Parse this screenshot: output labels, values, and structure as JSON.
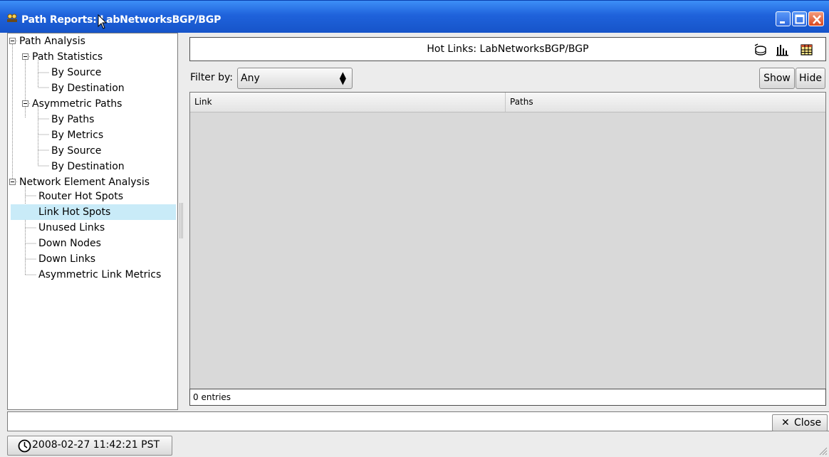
{
  "window": {
    "title": "Path Reports: LabNetworksBGP/BGP"
  },
  "tree": {
    "items": [
      {
        "label": "Path Analysis",
        "expander": "−"
      },
      {
        "label": "Path Statistics",
        "expander": "−"
      },
      {
        "label": "By Source"
      },
      {
        "label": "By Destination"
      },
      {
        "label": "Asymmetric Paths",
        "expander": "−"
      },
      {
        "label": "By Paths"
      },
      {
        "label": "By Metrics"
      },
      {
        "label": "By Source"
      },
      {
        "label": "By Destination"
      },
      {
        "label": "Network Element Analysis",
        "expander": "−"
      },
      {
        "label": "Router Hot Spots"
      },
      {
        "label": "Link Hot Spots",
        "selected": true
      },
      {
        "label": "Unused Links"
      },
      {
        "label": "Down Nodes"
      },
      {
        "label": "Down Links"
      },
      {
        "label": "Asymmetric Link Metrics"
      }
    ]
  },
  "report": {
    "title": "Hot Links: LabNetworksBGP/BGP",
    "tools": [
      "database-icon",
      "bar-chart-icon",
      "table-icon"
    ]
  },
  "filter": {
    "label": "Filter by:",
    "selected": "Any"
  },
  "buttons": {
    "show": "Show",
    "hide": "Hide",
    "close": "Close"
  },
  "table": {
    "columns": [
      "Link",
      "Paths"
    ],
    "rows": [],
    "entries_text": "0 entries"
  },
  "status": {
    "timestamp": "2008-02-27 11:42:21 PST"
  },
  "colors": {
    "titlebar": "#1f62db",
    "selection": "#c9ebf8",
    "table_bg": "#d9d9d9"
  }
}
